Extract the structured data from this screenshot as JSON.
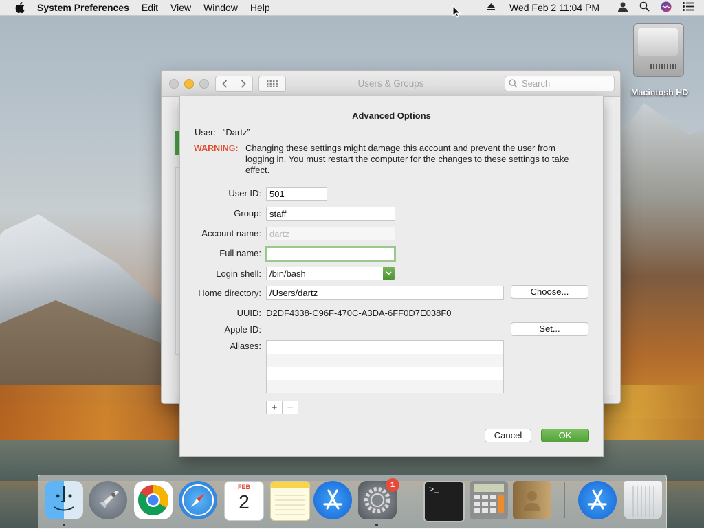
{
  "menubar": {
    "app_name": "System Preferences",
    "items": [
      "Edit",
      "View",
      "Window",
      "Help"
    ],
    "clock": "Wed Feb 2  11:04 PM"
  },
  "desktop": {
    "drive_label": "Macintosh HD"
  },
  "window": {
    "title": "Users & Groups",
    "search_placeholder": "Search"
  },
  "sheet": {
    "title": "Advanced Options",
    "user_label": "User:",
    "user_value": "“Dartz”",
    "warning_label": "WARNING:",
    "warning_text": "Changing these settings might damage this account and prevent the user from logging in. You must restart the computer for the changes to these settings to take effect.",
    "fields": {
      "user_id": {
        "label": "User ID:",
        "value": "501"
      },
      "group": {
        "label": "Group:",
        "value": "staff"
      },
      "account_name": {
        "label": "Account name:",
        "value": "dartz"
      },
      "full_name": {
        "label": "Full name:",
        "value": ""
      },
      "login_shell": {
        "label": "Login shell:",
        "value": "/bin/bash"
      },
      "home_directory": {
        "label": "Home directory:",
        "value": "/Users/dartz"
      },
      "uuid": {
        "label": "UUID:",
        "value": "D2DF4338-C96F-470C-A3DA-6FF0D7E038F0"
      },
      "apple_id": {
        "label": "Apple ID:",
        "value": ""
      },
      "aliases": {
        "label": "Aliases:"
      }
    },
    "buttons": {
      "choose": "Choose...",
      "set": "Set...",
      "add": "+",
      "remove": "−",
      "cancel": "Cancel",
      "ok": "OK"
    }
  },
  "dock": {
    "apps": [
      "Finder",
      "Launchpad",
      "Google Chrome",
      "Safari",
      "Calendar",
      "Notes",
      "App Store",
      "System Preferences",
      "Terminal",
      "Calculator",
      "Contacts",
      "App Store",
      "Trash"
    ],
    "calendar_month": "FEB",
    "calendar_day": "2",
    "system_prefs_badge": "1",
    "terminal_prompt": ">_"
  },
  "colors": {
    "warning": "#e14a2b",
    "ok_button": "#5aa840",
    "focus_ring": "#9bc88c"
  }
}
